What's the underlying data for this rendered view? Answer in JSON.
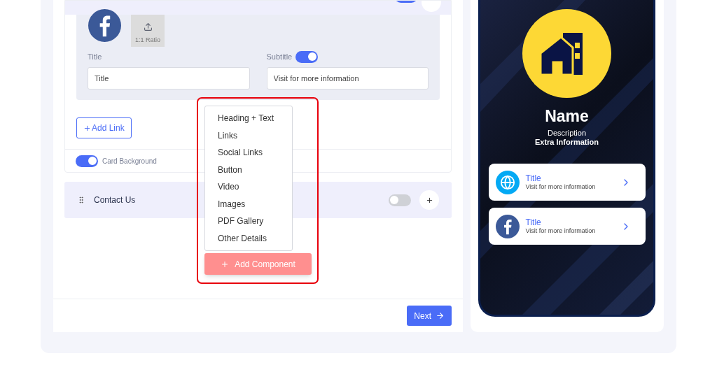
{
  "top_section": {
    "on": true
  },
  "link_editor": {
    "upload_label": "1:1 Ratio",
    "title_label": "Title",
    "title_value": "Title",
    "subtitle_label": "Subtitle",
    "subtitle_on": true,
    "subtitle_value": "Visit for more information"
  },
  "add_link": "Add Link",
  "card_background": {
    "label": "Card Background",
    "on": true
  },
  "sections": [
    {
      "title": "Contact Us",
      "on": false
    }
  ],
  "menu": {
    "items": [
      "Heading + Text",
      "Links",
      "Social Links",
      "Button",
      "Video",
      "Images",
      "PDF Gallery",
      "Other Details"
    ],
    "button": "Add Component"
  },
  "next": "Next",
  "preview": {
    "name": "Name",
    "description": "Description",
    "extra": "Extra Information",
    "links": [
      {
        "kind": "globe",
        "title": "Title",
        "subtitle": "Visit for more information"
      },
      {
        "kind": "facebook",
        "title": "Title",
        "subtitle": "Visit for more information"
      }
    ]
  }
}
